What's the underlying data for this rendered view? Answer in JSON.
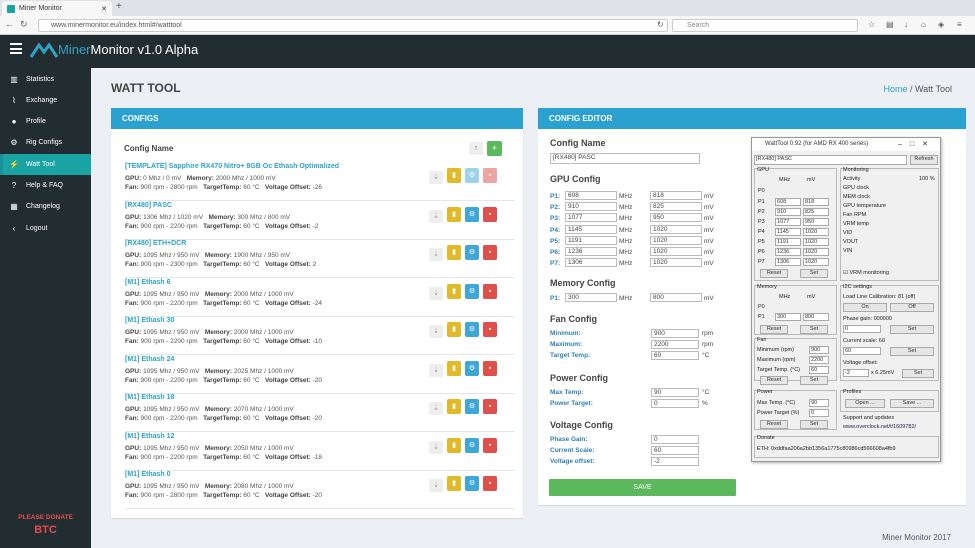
{
  "browser": {
    "tab_title": "Miner Monitor",
    "url": "www.minermonitor.eu/index.html#/watttool",
    "search_placeholder": "Search"
  },
  "app": {
    "logo_text_a": "Miner",
    "logo_text_b": "Monitor v1.0 Alpha"
  },
  "sidebar": {
    "items": [
      {
        "label": "Statistics",
        "icon": "bar-chart-icon"
      },
      {
        "label": "Exchange",
        "icon": "line-chart-icon"
      },
      {
        "label": "Profile",
        "icon": "user-icon"
      },
      {
        "label": "Rig Configs",
        "icon": "gears-icon"
      },
      {
        "label": "Watt Tool",
        "icon": "bolt-icon"
      },
      {
        "label": "Help & FAQ",
        "icon": "question-icon"
      },
      {
        "label": "Changelog",
        "icon": "calendar-icon"
      },
      {
        "label": "Logout",
        "icon": "chevron-left-icon"
      }
    ],
    "donate_label": "PLEASE DONATE",
    "donate_coin": "BTC"
  },
  "page": {
    "title": "WATT TOOL",
    "breadcrumb_home": "Home",
    "breadcrumb_current": "Watt Tool",
    "footer": "Miner Monitor 2017"
  },
  "configs_panel": {
    "title": "CONFIGS",
    "column": "Config Name",
    "items": [
      {
        "name": "[TEMPLATE] Sapphire RX470 Nitro+ 8GB Oc Ethash Optimalized",
        "gpu": "0 Mhz / 0 mV",
        "memory": "2000 Mhz / 1000 mV",
        "fan": "900 rpm - 2800 rpm",
        "target": "60 °C",
        "voltage": "-26"
      },
      {
        "name": "[RX480] PASC",
        "gpu": "1306 Mhz / 1020 mV",
        "memory": "300 Mhz / 800 mV",
        "fan": "900 rpm - 2200 rpm",
        "target": "60 °C",
        "voltage": "-2"
      },
      {
        "name": "[RX480] ETH+DCR",
        "gpu": "1095 Mhz / 950 mV",
        "memory": "1900 Mhz / 950 mV",
        "fan": "900 rpm - 2300 rpm",
        "target": "60 °C",
        "voltage": "2"
      },
      {
        "name": "[M1] Ethash 6",
        "gpu": "1095 Mhz / 950 mV",
        "memory": "2000 Mhz / 1000 mV",
        "fan": "900 rpm - 2200 rpm",
        "target": "60 °C",
        "voltage": "-24"
      },
      {
        "name": "[M1] Ethash 30",
        "gpu": "1095 Mhz / 950 mV",
        "memory": "2000 Mhz / 1000 mV",
        "fan": "900 rpm - 2200 rpm",
        "target": "60 °C",
        "voltage": "-10"
      },
      {
        "name": "[M1] Ethash 24",
        "gpu": "1095 Mhz / 950 mV",
        "memory": "2025 Mhz / 1000 mV",
        "fan": "900 rpm - 2200 rpm",
        "target": "60 °C",
        "voltage": "-20"
      },
      {
        "name": "[M1] Ethash 18",
        "gpu": "1095 Mhz / 950 mV",
        "memory": "2070 Mhz / 1000 mV",
        "fan": "900 rpm - 2200 rpm",
        "target": "60 °C",
        "voltage": "-20"
      },
      {
        "name": "[M1] Ethash 12",
        "gpu": "1095 Mhz / 950 mV",
        "memory": "2050 Mhz / 1000 mV",
        "fan": "900 rpm - 2200 rpm",
        "target": "60 °C",
        "voltage": "-18"
      },
      {
        "name": "[M1] Ethash 0",
        "gpu": "1095 Mhz / 950 mV",
        "memory": "2080 Mhz / 1000 mV",
        "fan": "900 rpm - 2800 rpm",
        "target": "60 °C",
        "voltage": "-20"
      }
    ],
    "labels": {
      "gpu": "GPU:",
      "memory": "Memory:",
      "fan": "Fan:",
      "target": "TargetTemp:",
      "voltage": "Voltage Offset:"
    }
  },
  "editor": {
    "title": "CONFIG EDITOR",
    "config_name_label": "Config Name",
    "config_name": "[RX480] PASC",
    "gpu_label": "GPU Config",
    "gpu": [
      {
        "p": "P1:",
        "mhz": "608",
        "mv": "818"
      },
      {
        "p": "P2:",
        "mhz": "910",
        "mv": "825"
      },
      {
        "p": "P3:",
        "mhz": "1077",
        "mv": "950"
      },
      {
        "p": "P4:",
        "mhz": "1145",
        "mv": "1020"
      },
      {
        "p": "P5:",
        "mhz": "1191",
        "mv": "1020"
      },
      {
        "p": "P6:",
        "mhz": "1236",
        "mv": "1020"
      },
      {
        "p": "P7:",
        "mhz": "1306",
        "mv": "1020"
      }
    ],
    "mhz": "MHz",
    "mv": "mV",
    "memory_label": "Memory Config",
    "memory": {
      "p": "P1:",
      "mhz": "300",
      "mv": "800"
    },
    "fan_label": "Fan Config",
    "fan": {
      "min_label": "Minimum:",
      "min": "900",
      "max_label": "Maximum:",
      "max": "2200",
      "temp_label": "Target Temp:",
      "temp": "60",
      "rpm": "rpm",
      "c": "°C"
    },
    "power_label": "Power Config",
    "power": {
      "maxtemp_label": "Max Temp:",
      "maxtemp": "90",
      "target_label": "Power Target:",
      "target": "0",
      "pct": "%"
    },
    "voltage_label": "Voltage Config",
    "voltage": {
      "phase_label": "Phase Gain:",
      "phase": "0",
      "scale_label": "Current Scale:",
      "scale": "60",
      "offset_label": "Voltage offset:",
      "offset": "-2"
    },
    "save": "SAVE"
  },
  "watttool": {
    "title": "WattTool 0.92 (for AMD RX 400 series)",
    "device": "[RX480] PASC",
    "refresh": "Refresh",
    "gpu": "GPU",
    "mhz": "MHz",
    "mv": "mV",
    "p0": "P0",
    "states": [
      {
        "p": "P1",
        "mhz": "608",
        "mv": "818"
      },
      {
        "p": "P2",
        "mhz": "910",
        "mv": "825"
      },
      {
        "p": "P3",
        "mhz": "1077",
        "mv": "950"
      },
      {
        "p": "P4",
        "mhz": "1145",
        "mv": "1020"
      },
      {
        "p": "P5",
        "mhz": "1191",
        "mv": "1020"
      },
      {
        "p": "P6",
        "mhz": "1236",
        "mv": "1020"
      },
      {
        "p": "P7",
        "mhz": "1306",
        "mv": "1020"
      }
    ],
    "reset": "Reset",
    "set": "Set",
    "monitoring": "Monitoring",
    "activity": "Activity",
    "activity_val": "100 %",
    "mon_items": [
      "GPU clock",
      "MEM clock",
      "GPU temperature",
      "Fan RPM",
      "VRM temp",
      "VID",
      "VOUT",
      "VIN"
    ],
    "vrm": "VRM monitoring",
    "memory": "Memory",
    "mem_p0": "P0",
    "mem_p1": "P1",
    "mem_mhz": "300",
    "mem_mv": "800",
    "i2c": "I2C settings",
    "llc": "Load Line Calibration: 81 (off)",
    "on": "On",
    "off": "Off",
    "phase": "Phase gain: 000000",
    "phase_val": "0",
    "scale": "Current scale: 60",
    "scale_val": "60",
    "voffset": "Voltage offset:",
    "voffset_val": "-2",
    "vunit": "x 6.25mV",
    "fan": "Fan",
    "fmin": "Minimum (rpm)",
    "fmin_val": "900",
    "fmax": "Maximum (rpm)",
    "fmax_val": "2200",
    "ftemp": "Target Temp. (°C)",
    "ftemp_val": "60",
    "power": "Power",
    "pmax": "Max Temp. (°C)",
    "pmax_val": "90",
    "ptarget": "Power Target (%)",
    "ptarget_val": "0",
    "profiles": "Profiles",
    "open": "Open ...",
    "savep": "Save ...",
    "support": "Support and updates",
    "support_url": "www.overclock.net/t/1609782/",
    "donate": "Donate",
    "eth": "ETH:  0xddfaa206a2bb1356a1775c80986cd566608a4fb9"
  },
  "colors": {
    "sidebar": "#222d32",
    "accent": "#1aa3a3",
    "panel_head": "#2aa1cf",
    "save": "#5cb85c"
  }
}
